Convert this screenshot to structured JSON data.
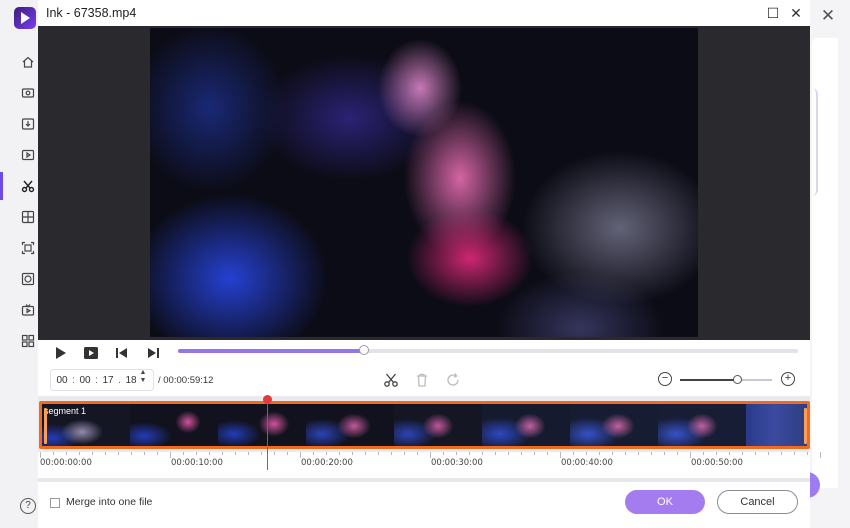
{
  "window": {
    "title": "Ink - 67358.mp4"
  },
  "nav": {
    "items": [
      "home-icon",
      "screen-record-icon",
      "download-icon",
      "video-player-icon",
      "cut-icon",
      "compress-icon",
      "crop-icon",
      "watermark-icon",
      "tv-icon",
      "apps-icon"
    ],
    "active": "cut-icon"
  },
  "player": {
    "progress": 0.3
  },
  "time_input": {
    "hours": "00",
    "minutes": "00",
    "seconds": "17",
    "frames": "18",
    "duration": "/ 00:00:59:12"
  },
  "zoom": {
    "level": 0.62
  },
  "timeline": {
    "segment_label": "segment 1",
    "playhead_time_fraction": 0.299,
    "ruler_labels": [
      "00:00:00:00",
      "00:00:10:00",
      "00:00:20:00",
      "00:00:30:00",
      "00:00:40:00",
      "00:00:50:00"
    ]
  },
  "footer": {
    "merge_label": "Merge into one file",
    "merge_checked": false,
    "ok_label": "OK",
    "cancel_label": "Cancel"
  },
  "colors": {
    "accent": "#a57cf0",
    "segment_border": "#f26b1d",
    "playhead": "#e03a3a"
  }
}
